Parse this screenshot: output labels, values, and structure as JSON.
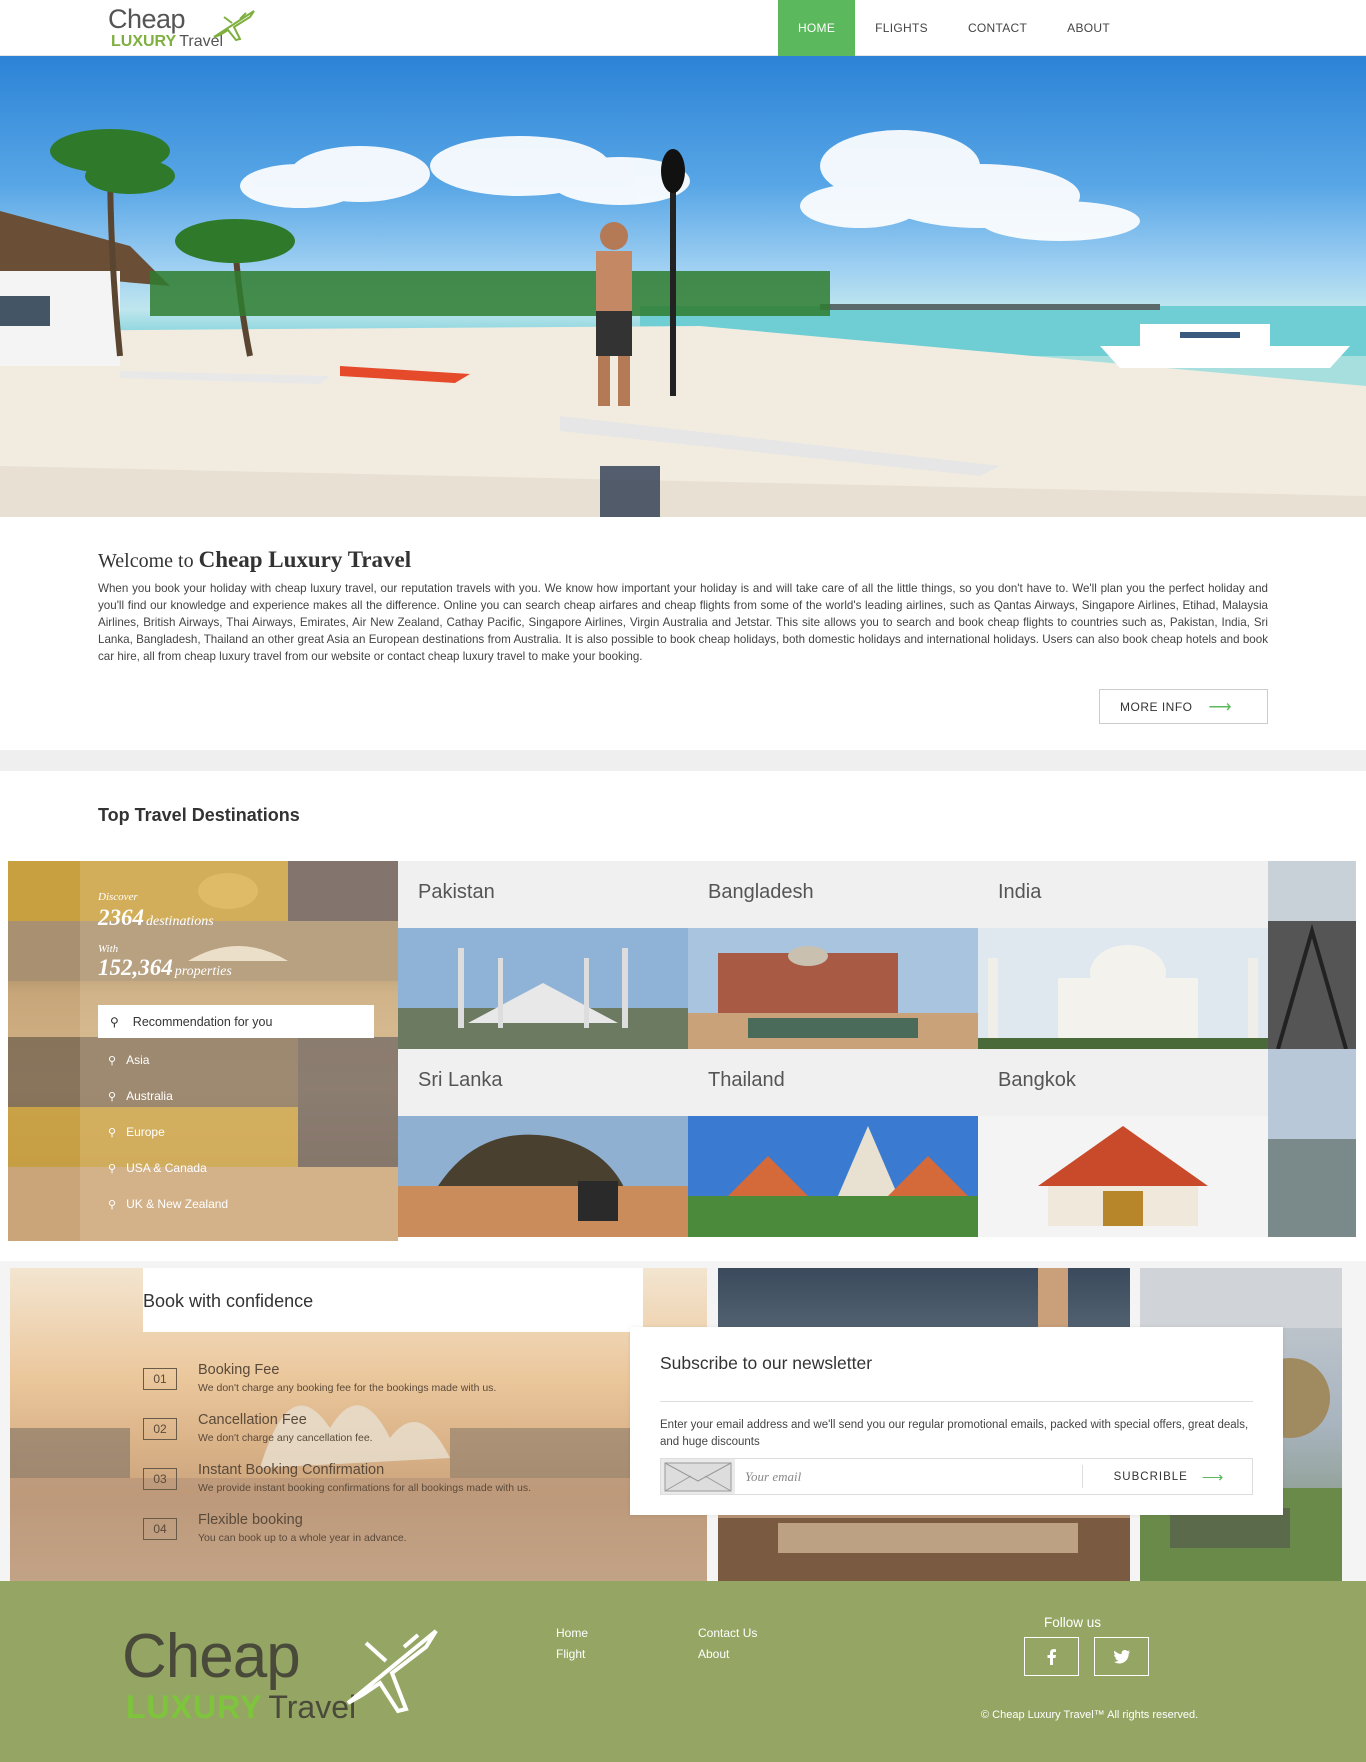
{
  "header": {
    "logo": {
      "line1": "Cheap",
      "line2_brand": "LUXURY",
      "line2_rest": "Travel"
    },
    "nav": [
      {
        "label": "HOME",
        "active": true
      },
      {
        "label": "FLIGHTS",
        "active": false
      },
      {
        "label": "CONTACT",
        "active": false
      },
      {
        "label": "ABOUT",
        "active": false
      }
    ],
    "accent_color": "#5cb85c"
  },
  "welcome": {
    "title_prefix": "Welcome to",
    "title_brand": "Cheap Luxury Travel",
    "body": "When you book your holiday with cheap luxury travel, our reputation travels with you. We know how important your holiday is and will take care of all the little things, so you don't have to. We'll plan you the perfect holiday and you'll find our knowledge and experience makes all the difference. Online you can search cheap airfares and cheap flights from some of the world's leading airlines, such as Qantas Airways, Singapore Airlines, Etihad, Malaysia Airlines, British Airways, Thai Airways, Emirates, Air New Zealand, Cathay Pacific, Singapore Airlines, Virgin Australia and Jetstar. This site allows you to search and book cheap flights to countries such as, Pakistan, India, Sri Lanka, Bangladesh, Thailand an other great Asia an European destinations from Australia. It is also possible to book cheap holidays, both domestic holidays and international holidays. Users can also book cheap hotels and book car hire, all from cheap luxury travel from our website or contact cheap luxury travel to make your booking.",
    "more_info": "MORE INFO"
  },
  "destinations": {
    "heading": "Top Travel Destinations",
    "promo": {
      "discover": "Discover",
      "dest_count": "2364",
      "dest_word": "destinations",
      "with": "With",
      "prop_count": "152,364",
      "prop_word": "properties",
      "recommendation": "Recommendation for you",
      "regions": [
        "Asia",
        "Australia",
        "Europe",
        "USA & Canada",
        "UK & New Zealand"
      ]
    },
    "cards": [
      {
        "name": "Pakistan"
      },
      {
        "name": "Bangladesh"
      },
      {
        "name": "India"
      },
      {
        "name": "Sri Lanka"
      },
      {
        "name": "Thailand"
      },
      {
        "name": "Bangkok"
      }
    ]
  },
  "book": {
    "title": "Book with confidence",
    "features": [
      {
        "num": "01",
        "title": "Booking Fee",
        "desc": "We don't charge any booking fee for the bookings made with us."
      },
      {
        "num": "02",
        "title": "Cancellation Fee",
        "desc": "We don't charge any cancellation fee."
      },
      {
        "num": "03",
        "title": "Instant Booking Confirmation",
        "desc": "We provide instant booking confirmations for all bookings made with us."
      },
      {
        "num": "04",
        "title": "Flexible booking",
        "desc": "You can book up to a whole year in advance."
      }
    ]
  },
  "newsletter": {
    "title": "Subscribe to our newsletter",
    "text": "Enter your email address and we'll send you our regular promotional emails, packed with special offers, great deals, and huge discounts",
    "placeholder": "Your email",
    "button": "SUBCRIBLE"
  },
  "footer": {
    "logo": {
      "line1": "Cheap",
      "line2_brand": "LUXURY",
      "line2_rest": "Travel"
    },
    "links": [
      "Home",
      "Flight",
      "Contact Us",
      "About"
    ],
    "follow": "Follow us",
    "social": [
      "facebook",
      "twitter"
    ],
    "copyright": "© Cheap Luxury Travel™ All rights reserved.",
    "bg_color": "#95a664"
  }
}
